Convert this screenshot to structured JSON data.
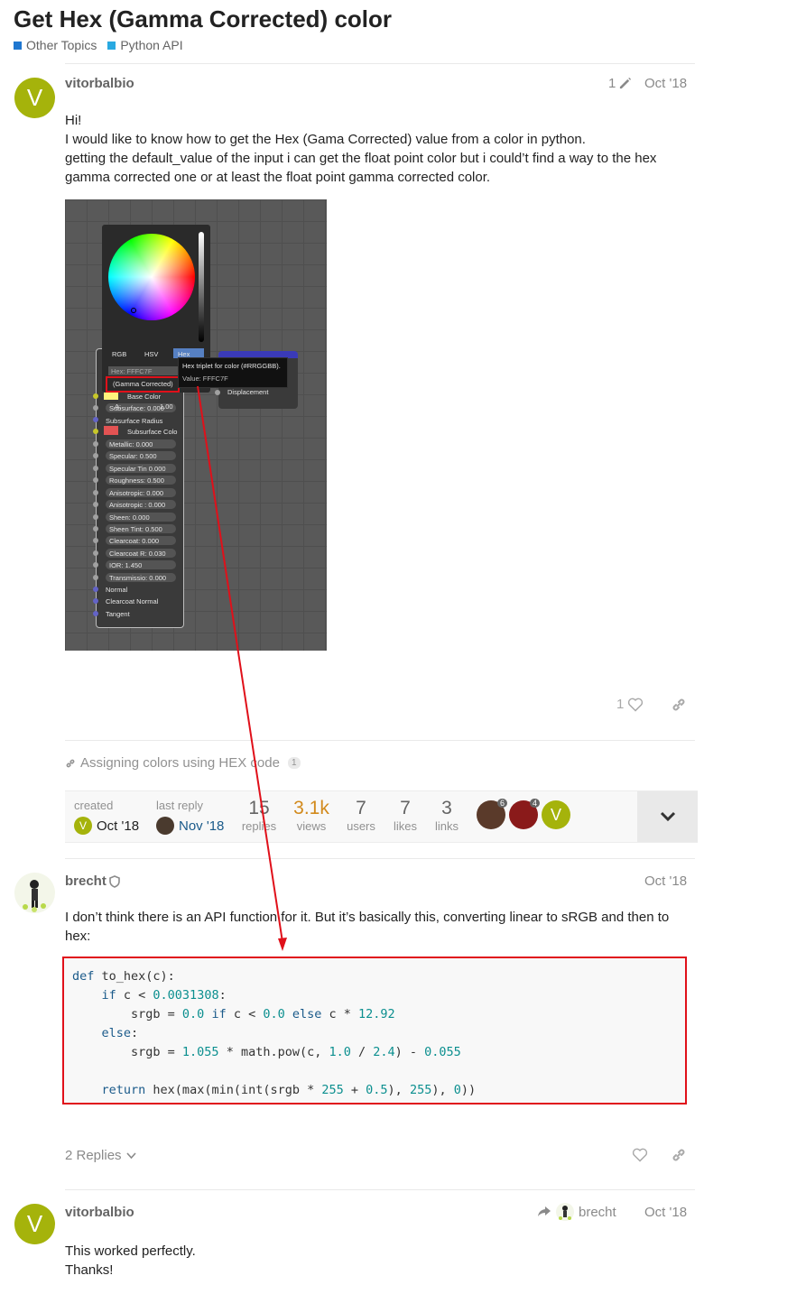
{
  "topic": {
    "title": "Get Hex (Gamma Corrected) color",
    "categories": [
      {
        "label": "Other Topics",
        "color": "#1f77d0"
      },
      {
        "label": "Python API",
        "color": "#29a9e1"
      }
    ]
  },
  "post1": {
    "avatar_letter": "V",
    "avatar_color": "#a5b30b",
    "username": "vitorbalbio",
    "edit_count": "1",
    "date": "Oct '18",
    "lines": [
      "Hi!",
      "I would like to know how to get the Hex (Gama Corrected) value from a color in python.",
      "getting the default_value of the input i can get the float point color but i could’t find a way to the hex",
      "gamma corrected one or at least the float point gamma corrected color."
    ],
    "likes": "1",
    "screenshot": {
      "tabs": [
        "RGB",
        "HSV",
        "Hex"
      ],
      "hex_field": "Hex: FFFC7F",
      "gamma_label": "(Gamma Corrected)",
      "alpha_label": "A:",
      "alpha_value": "1.00",
      "tooltip_title": "Hex triplet for color (#RRGGBB).",
      "tooltip_value": "Value: FFFC7F",
      "displacement": "Displacement",
      "rows": [
        "Base Color",
        "Subsurface: 0.000",
        "Subsurface Radius",
        "Subsurface Colo",
        "Metallic: 0.000",
        "Specular: 0.500",
        "Specular Tin 0.000",
        "Roughness: 0.500",
        "Anisotropic: 0.000",
        "Anisotropic : 0.000",
        "Sheen: 0.000",
        "Sheen Tint: 0.500",
        "Clearcoat: 0.000",
        "Clearcoat R: 0.030",
        "IOR: 1.450",
        "Transmissio: 0.000",
        "Normal",
        "Clearcoat Normal",
        "Tangent"
      ]
    }
  },
  "link": {
    "label": "Assigning colors using HEX code",
    "count": "1"
  },
  "topic_map": {
    "created_label": "created",
    "created_date": "Oct '18",
    "last_reply_label": "last reply",
    "last_reply_date": "Nov '18",
    "stats": [
      {
        "value": "15",
        "label": "replies"
      },
      {
        "value": "3.1k",
        "label": "views"
      },
      {
        "value": "7",
        "label": "users"
      },
      {
        "value": "7",
        "label": "likes"
      },
      {
        "value": "3",
        "label": "links"
      }
    ],
    "participants": [
      {
        "badge": "6"
      },
      {
        "badge": "4"
      },
      {
        "letter": "V"
      }
    ]
  },
  "post2": {
    "username": "brecht",
    "date": "Oct '18",
    "text": "I don’t think there is an API function for it. But it’s basically this, converting linear to sRGB and then to hex:",
    "replies_label": "2 Replies"
  },
  "post3": {
    "avatar_letter": "V",
    "username": "vitorbalbio",
    "reply_to": "brecht",
    "date": "Oct '18",
    "lines": [
      "This worked perfectly.",
      "Thanks!"
    ]
  },
  "colors": {
    "annotation_red": "#e0101a",
    "views_orange": "#d28a1c"
  }
}
